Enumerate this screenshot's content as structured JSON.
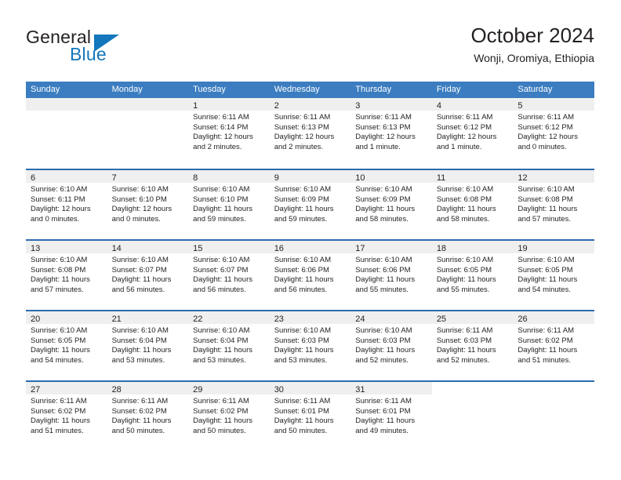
{
  "brand": {
    "word_one": "General",
    "word_two": "Blue",
    "logo_icon": "triangle-logo-icon",
    "accent_color": "#1476bc"
  },
  "header": {
    "title": "October 2024",
    "subtitle": "Wonji, Oromiya, Ethiopia"
  },
  "theme": {
    "header_blue": "#3b7dc0",
    "row_divider_blue": "#2b6caf",
    "date_band_gray": "#efefef",
    "text_color": "#231f20"
  },
  "calendar": {
    "weekdays": [
      "Sunday",
      "Monday",
      "Tuesday",
      "Wednesday",
      "Thursday",
      "Friday",
      "Saturday"
    ],
    "weeks": [
      [
        {
          "day": "",
          "sunrise": "",
          "sunset": "",
          "daylight": "",
          "empty": true
        },
        {
          "day": "",
          "sunrise": "",
          "sunset": "",
          "daylight": "",
          "empty": true
        },
        {
          "day": "1",
          "sunrise": "Sunrise: 6:11 AM",
          "sunset": "Sunset: 6:14 PM",
          "daylight": "Daylight: 12 hours and 2 minutes."
        },
        {
          "day": "2",
          "sunrise": "Sunrise: 6:11 AM",
          "sunset": "Sunset: 6:13 PM",
          "daylight": "Daylight: 12 hours and 2 minutes."
        },
        {
          "day": "3",
          "sunrise": "Sunrise: 6:11 AM",
          "sunset": "Sunset: 6:13 PM",
          "daylight": "Daylight: 12 hours and 1 minute."
        },
        {
          "day": "4",
          "sunrise": "Sunrise: 6:11 AM",
          "sunset": "Sunset: 6:12 PM",
          "daylight": "Daylight: 12 hours and 1 minute."
        },
        {
          "day": "5",
          "sunrise": "Sunrise: 6:11 AM",
          "sunset": "Sunset: 6:12 PM",
          "daylight": "Daylight: 12 hours and 0 minutes."
        }
      ],
      [
        {
          "day": "6",
          "sunrise": "Sunrise: 6:10 AM",
          "sunset": "Sunset: 6:11 PM",
          "daylight": "Daylight: 12 hours and 0 minutes."
        },
        {
          "day": "7",
          "sunrise": "Sunrise: 6:10 AM",
          "sunset": "Sunset: 6:10 PM",
          "daylight": "Daylight: 12 hours and 0 minutes."
        },
        {
          "day": "8",
          "sunrise": "Sunrise: 6:10 AM",
          "sunset": "Sunset: 6:10 PM",
          "daylight": "Daylight: 11 hours and 59 minutes."
        },
        {
          "day": "9",
          "sunrise": "Sunrise: 6:10 AM",
          "sunset": "Sunset: 6:09 PM",
          "daylight": "Daylight: 11 hours and 59 minutes."
        },
        {
          "day": "10",
          "sunrise": "Sunrise: 6:10 AM",
          "sunset": "Sunset: 6:09 PM",
          "daylight": "Daylight: 11 hours and 58 minutes."
        },
        {
          "day": "11",
          "sunrise": "Sunrise: 6:10 AM",
          "sunset": "Sunset: 6:08 PM",
          "daylight": "Daylight: 11 hours and 58 minutes."
        },
        {
          "day": "12",
          "sunrise": "Sunrise: 6:10 AM",
          "sunset": "Sunset: 6:08 PM",
          "daylight": "Daylight: 11 hours and 57 minutes."
        }
      ],
      [
        {
          "day": "13",
          "sunrise": "Sunrise: 6:10 AM",
          "sunset": "Sunset: 6:08 PM",
          "daylight": "Daylight: 11 hours and 57 minutes."
        },
        {
          "day": "14",
          "sunrise": "Sunrise: 6:10 AM",
          "sunset": "Sunset: 6:07 PM",
          "daylight": "Daylight: 11 hours and 56 minutes."
        },
        {
          "day": "15",
          "sunrise": "Sunrise: 6:10 AM",
          "sunset": "Sunset: 6:07 PM",
          "daylight": "Daylight: 11 hours and 56 minutes."
        },
        {
          "day": "16",
          "sunrise": "Sunrise: 6:10 AM",
          "sunset": "Sunset: 6:06 PM",
          "daylight": "Daylight: 11 hours and 56 minutes."
        },
        {
          "day": "17",
          "sunrise": "Sunrise: 6:10 AM",
          "sunset": "Sunset: 6:06 PM",
          "daylight": "Daylight: 11 hours and 55 minutes."
        },
        {
          "day": "18",
          "sunrise": "Sunrise: 6:10 AM",
          "sunset": "Sunset: 6:05 PM",
          "daylight": "Daylight: 11 hours and 55 minutes."
        },
        {
          "day": "19",
          "sunrise": "Sunrise: 6:10 AM",
          "sunset": "Sunset: 6:05 PM",
          "daylight": "Daylight: 11 hours and 54 minutes."
        }
      ],
      [
        {
          "day": "20",
          "sunrise": "Sunrise: 6:10 AM",
          "sunset": "Sunset: 6:05 PM",
          "daylight": "Daylight: 11 hours and 54 minutes."
        },
        {
          "day": "21",
          "sunrise": "Sunrise: 6:10 AM",
          "sunset": "Sunset: 6:04 PM",
          "daylight": "Daylight: 11 hours and 53 minutes."
        },
        {
          "day": "22",
          "sunrise": "Sunrise: 6:10 AM",
          "sunset": "Sunset: 6:04 PM",
          "daylight": "Daylight: 11 hours and 53 minutes."
        },
        {
          "day": "23",
          "sunrise": "Sunrise: 6:10 AM",
          "sunset": "Sunset: 6:03 PM",
          "daylight": "Daylight: 11 hours and 53 minutes."
        },
        {
          "day": "24",
          "sunrise": "Sunrise: 6:10 AM",
          "sunset": "Sunset: 6:03 PM",
          "daylight": "Daylight: 11 hours and 52 minutes."
        },
        {
          "day": "25",
          "sunrise": "Sunrise: 6:11 AM",
          "sunset": "Sunset: 6:03 PM",
          "daylight": "Daylight: 11 hours and 52 minutes."
        },
        {
          "day": "26",
          "sunrise": "Sunrise: 6:11 AM",
          "sunset": "Sunset: 6:02 PM",
          "daylight": "Daylight: 11 hours and 51 minutes."
        }
      ],
      [
        {
          "day": "27",
          "sunrise": "Sunrise: 6:11 AM",
          "sunset": "Sunset: 6:02 PM",
          "daylight": "Daylight: 11 hours and 51 minutes."
        },
        {
          "day": "28",
          "sunrise": "Sunrise: 6:11 AM",
          "sunset": "Sunset: 6:02 PM",
          "daylight": "Daylight: 11 hours and 50 minutes."
        },
        {
          "day": "29",
          "sunrise": "Sunrise: 6:11 AM",
          "sunset": "Sunset: 6:02 PM",
          "daylight": "Daylight: 11 hours and 50 minutes."
        },
        {
          "day": "30",
          "sunrise": "Sunrise: 6:11 AM",
          "sunset": "Sunset: 6:01 PM",
          "daylight": "Daylight: 11 hours and 50 minutes."
        },
        {
          "day": "31",
          "sunrise": "Sunrise: 6:11 AM",
          "sunset": "Sunset: 6:01 PM",
          "daylight": "Daylight: 11 hours and 49 minutes."
        },
        {
          "day": "",
          "sunrise": "",
          "sunset": "",
          "daylight": "",
          "empty": true,
          "blank": true
        },
        {
          "day": "",
          "sunrise": "",
          "sunset": "",
          "daylight": "",
          "empty": true,
          "blank": true
        }
      ]
    ]
  }
}
